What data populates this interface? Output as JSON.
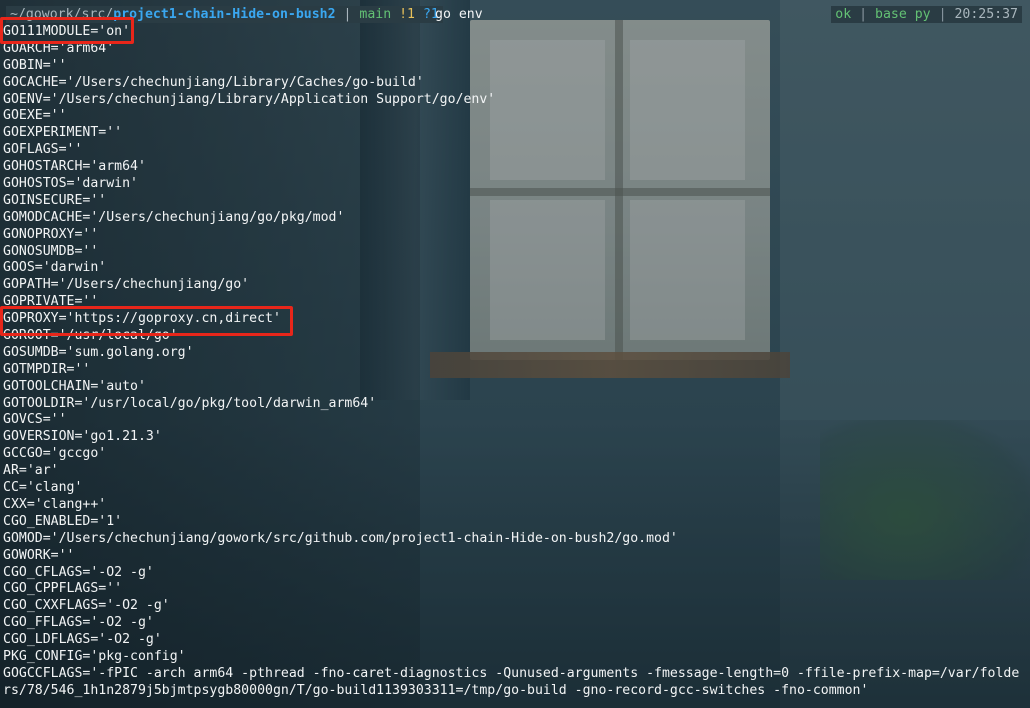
{
  "prompt": {
    "path_prefix": "~/gowork/src/",
    "path_dir": "project1-chain-Hide-on-bush2",
    "separator": "|",
    "branch": "main",
    "modified": "!1",
    "untracked": "?1",
    "command": "go env",
    "status_ok": "ok",
    "env_name": "base py",
    "time": "20:25:37"
  },
  "output_lines": [
    "GO111MODULE='on'",
    "GOARCH='arm64'",
    "GOBIN=''",
    "GOCACHE='/Users/chechunjiang/Library/Caches/go-build'",
    "GOENV='/Users/chechunjiang/Library/Application Support/go/env'",
    "GOEXE=''",
    "GOEXPERIMENT=''",
    "GOFLAGS=''",
    "GOHOSTARCH='arm64'",
    "GOHOSTOS='darwin'",
    "GOINSECURE=''",
    "GOMODCACHE='/Users/chechunjiang/go/pkg/mod'",
    "GONOPROXY=''",
    "GONOSUMDB=''",
    "GOOS='darwin'",
    "GOPATH='/Users/chechunjiang/go'",
    "GOPRIVATE=''",
    "GOPROXY='https://goproxy.cn,direct'",
    "GOROOT='/usr/local/go'",
    "GOSUMDB='sum.golang.org'",
    "GOTMPDIR=''",
    "GOTOOLCHAIN='auto'",
    "GOTOOLDIR='/usr/local/go/pkg/tool/darwin_arm64'",
    "GOVCS=''",
    "GOVERSION='go1.21.3'",
    "GCCGO='gccgo'",
    "AR='ar'",
    "CC='clang'",
    "CXX='clang++'",
    "CGO_ENABLED='1'",
    "GOMOD='/Users/chechunjiang/gowork/src/github.com/project1-chain-Hide-on-bush2/go.mod'",
    "GOWORK=''",
    "CGO_CFLAGS='-O2 -g'",
    "CGO_CPPFLAGS=''",
    "CGO_CXXFLAGS='-O2 -g'",
    "CGO_FFLAGS='-O2 -g'",
    "CGO_LDFLAGS='-O2 -g'",
    "PKG_CONFIG='pkg-config'",
    "GOGCCFLAGS='-fPIC -arch arm64 -pthread -fno-caret-diagnostics -Qunused-arguments -fmessage-length=0 -ffile-prefix-map=/var/folde",
    "rs/78/546_1h1n2879j5bjmtpsygb80000gn/T/go-build1139303311=/tmp/go-build -gno-record-gcc-switches -fno-common'"
  ],
  "colors": {
    "highlight_box": "#e8261a",
    "branch": "#63c174",
    "modified": "#e8c15a",
    "untracked": "#3aa7f0",
    "path": "#3aa7f0"
  }
}
